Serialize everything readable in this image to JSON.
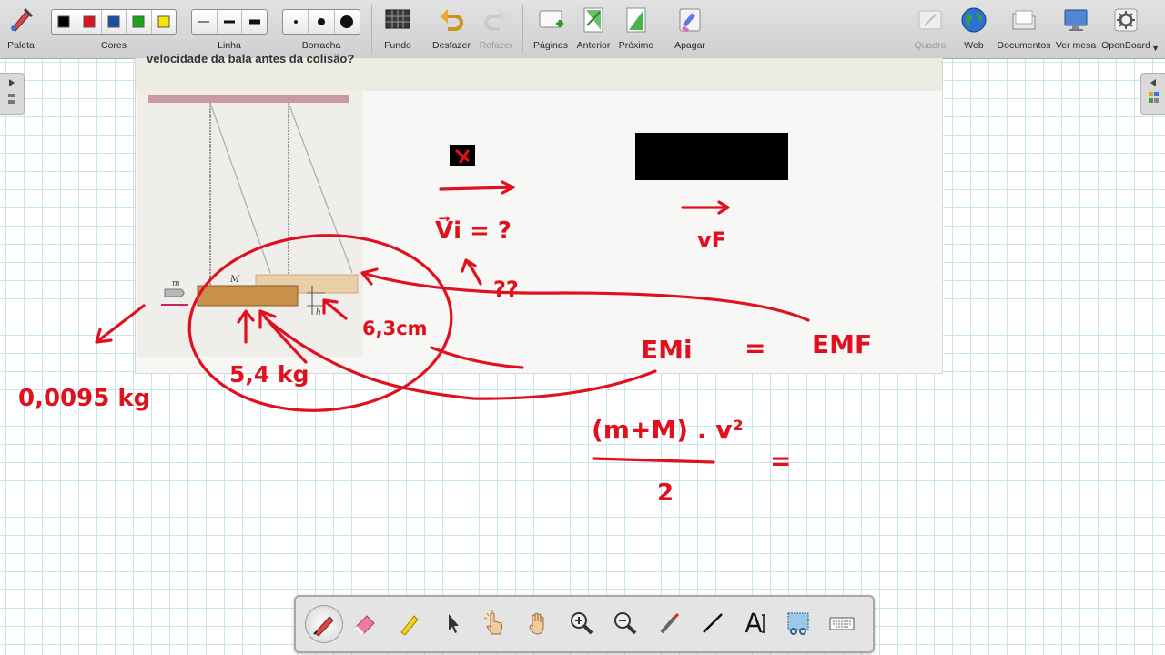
{
  "toolbar": {
    "palette_label": "Paleta",
    "colors_label": "Cores",
    "colors": [
      "#000000",
      "#e0101e",
      "#1c4fa0",
      "#19a61a",
      "#f3e600"
    ],
    "line_label": "Linha",
    "eraser_label": "Borracha",
    "background_label": "Fundo",
    "undo_label": "Desfazer",
    "redo_label": "Refazer",
    "pages_label": "Páginas",
    "previous_label": "Anterior",
    "next_label": "Próximo",
    "clear_label": "Apagar",
    "board_label": "Quadro",
    "web_label": "Web",
    "documents_label": "Documentos",
    "desktop_label": "Ver mesa",
    "openboard_label": "OpenBoard"
  },
  "document": {
    "title": "velocidade da bala antes da colisão?",
    "figure_labels": {
      "m": "m",
      "M": "M",
      "h": "h"
    }
  },
  "annotations": {
    "bullet_mass": "0,0095 kg",
    "block_mass": "5,4 kg",
    "height": "6,3cm",
    "initial_velocity": "V⃗i = ?",
    "question_marks": "??",
    "final_velocity": "vF",
    "energy_initial": "EMi",
    "equals": "=",
    "energy_final": "EMF",
    "kinetic_numerator": "(m+M) . v²",
    "kinetic_denominator": "2"
  },
  "dock_tools": [
    "pen-tool",
    "eraser-tool",
    "highlighter-tool",
    "select-tool",
    "interact-tool",
    "hand-tool",
    "zoom-in-tool",
    "zoom-out-tool",
    "laser-pointer-tool",
    "line-tool",
    "text-tool",
    "capture-tool",
    "keyboard-tool"
  ],
  "ink_color": "#e0101e"
}
